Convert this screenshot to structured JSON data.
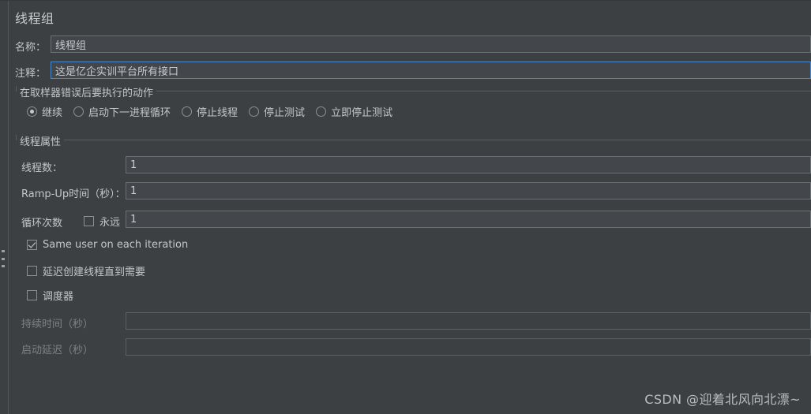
{
  "window": {
    "title": "线程组"
  },
  "fields": {
    "name": {
      "label": "名称：",
      "value": "线程组"
    },
    "comment": {
      "label": "注释：",
      "value": "这是亿企实训平台所有接口"
    }
  },
  "action_group": {
    "legend": "在取样器错误后要执行的动作",
    "options": [
      {
        "label": "继续",
        "selected": true
      },
      {
        "label": "启动下一进程循环",
        "selected": false
      },
      {
        "label": "停止线程",
        "selected": false
      },
      {
        "label": "停止测试",
        "selected": false
      },
      {
        "label": "立即停止测试",
        "selected": false
      }
    ]
  },
  "thread_properties": {
    "legend": "线程属性",
    "num_threads": {
      "label": "线程数：",
      "value": "1"
    },
    "ramp_up": {
      "label": "Ramp-Up时间（秒）：",
      "value": "1"
    },
    "loop_count": {
      "label": "循环次数",
      "forever_label": "永远",
      "forever_checked": false,
      "value": "1"
    },
    "same_user": {
      "label": "Same user on each iteration",
      "checked": true
    },
    "delay_create": {
      "label": "延迟创建线程直到需要",
      "checked": false
    },
    "scheduler": {
      "label": "调度器",
      "checked": false
    },
    "duration": {
      "label": "持续时间（秒）",
      "value": "",
      "enabled": false
    },
    "startup_delay": {
      "label": "启动延迟（秒）",
      "value": "",
      "enabled": false
    }
  },
  "watermark": {
    "text": "CSDN @迎着北风向北漂~"
  },
  "colors": {
    "background": "#3c4043",
    "field_background": "#43474b",
    "border": "#6a6f73",
    "focus_border": "#4a88c7",
    "text": "#c2c7cc",
    "disabled_text": "#7d8286"
  }
}
